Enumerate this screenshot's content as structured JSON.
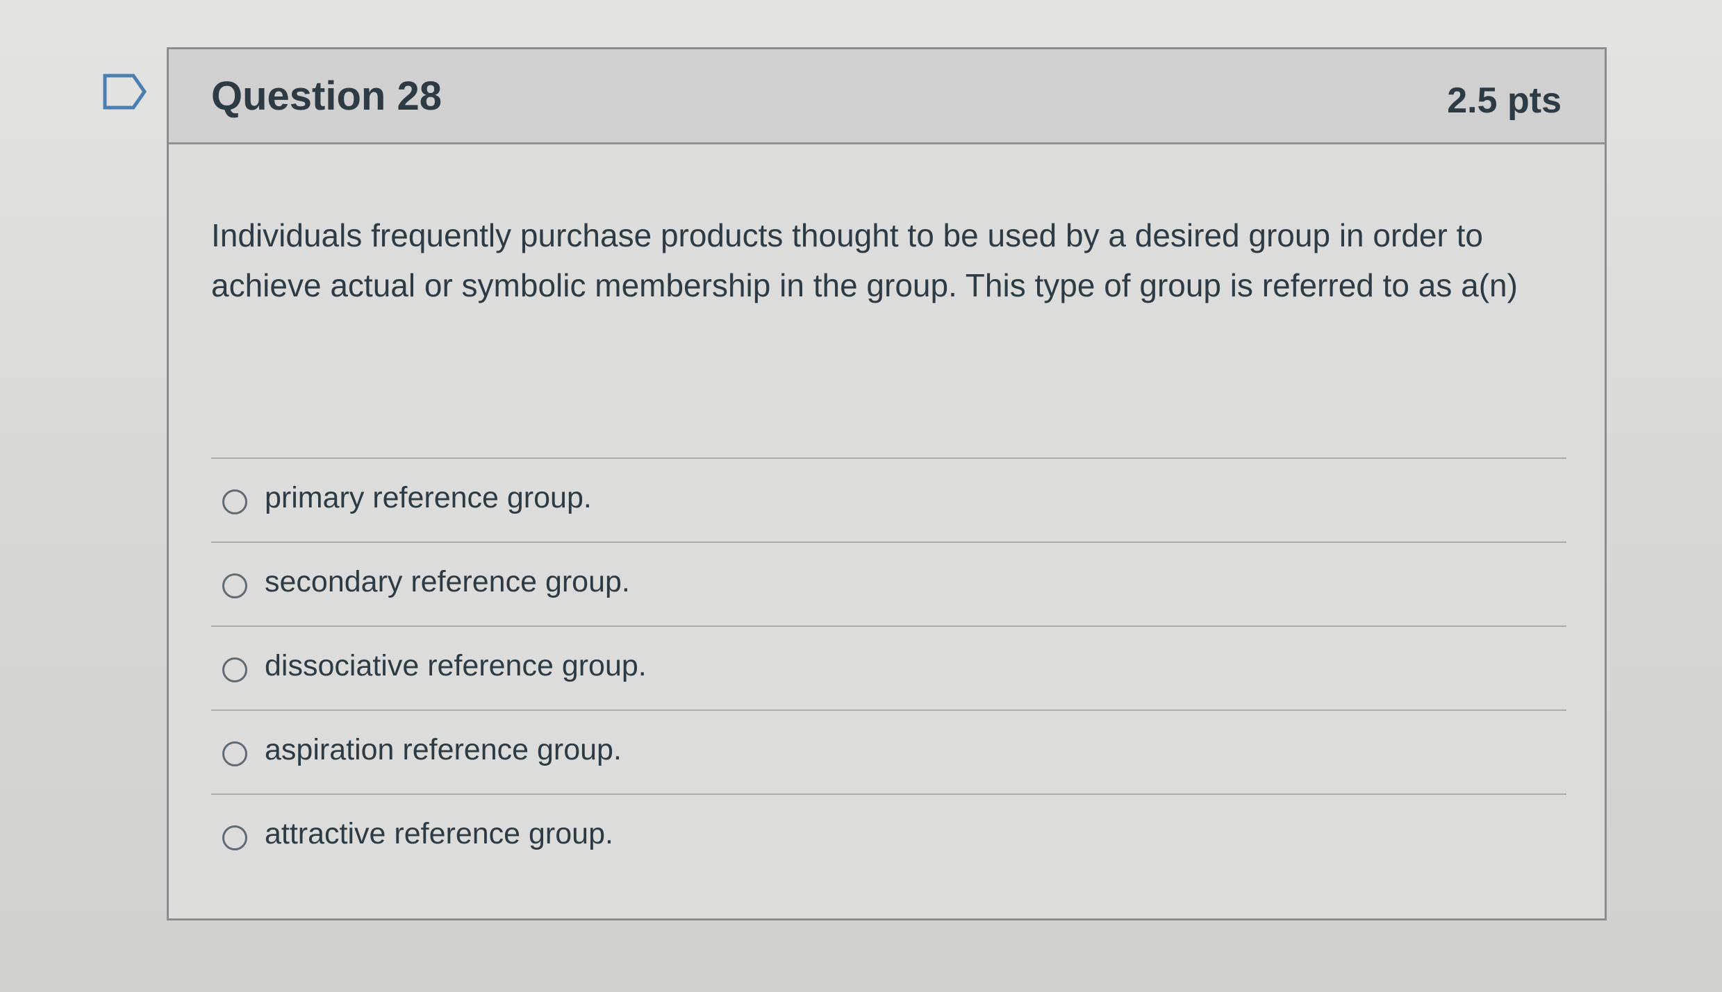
{
  "question": {
    "title": "Question 28",
    "points": "2.5 pts",
    "flag_icon": "flag-outline-icon",
    "text": "Individuals frequently purchase products thought to be used by a desired group in order to achieve actual or symbolic membership in the group. This type of group is referred to as a(n)"
  },
  "answers": [
    {
      "label": "primary reference group.",
      "selected": false
    },
    {
      "label": "secondary reference group.",
      "selected": false
    },
    {
      "label": "dissociative reference group.",
      "selected": false
    },
    {
      "label": "aspiration reference group.",
      "selected": false
    },
    {
      "label": "attractive reference group.",
      "selected": false
    }
  ],
  "colors": {
    "text": "#2d3b45",
    "header_bg": "#cfd0cf",
    "border": "#8a8c8e",
    "flag": "#4a7fb0"
  }
}
